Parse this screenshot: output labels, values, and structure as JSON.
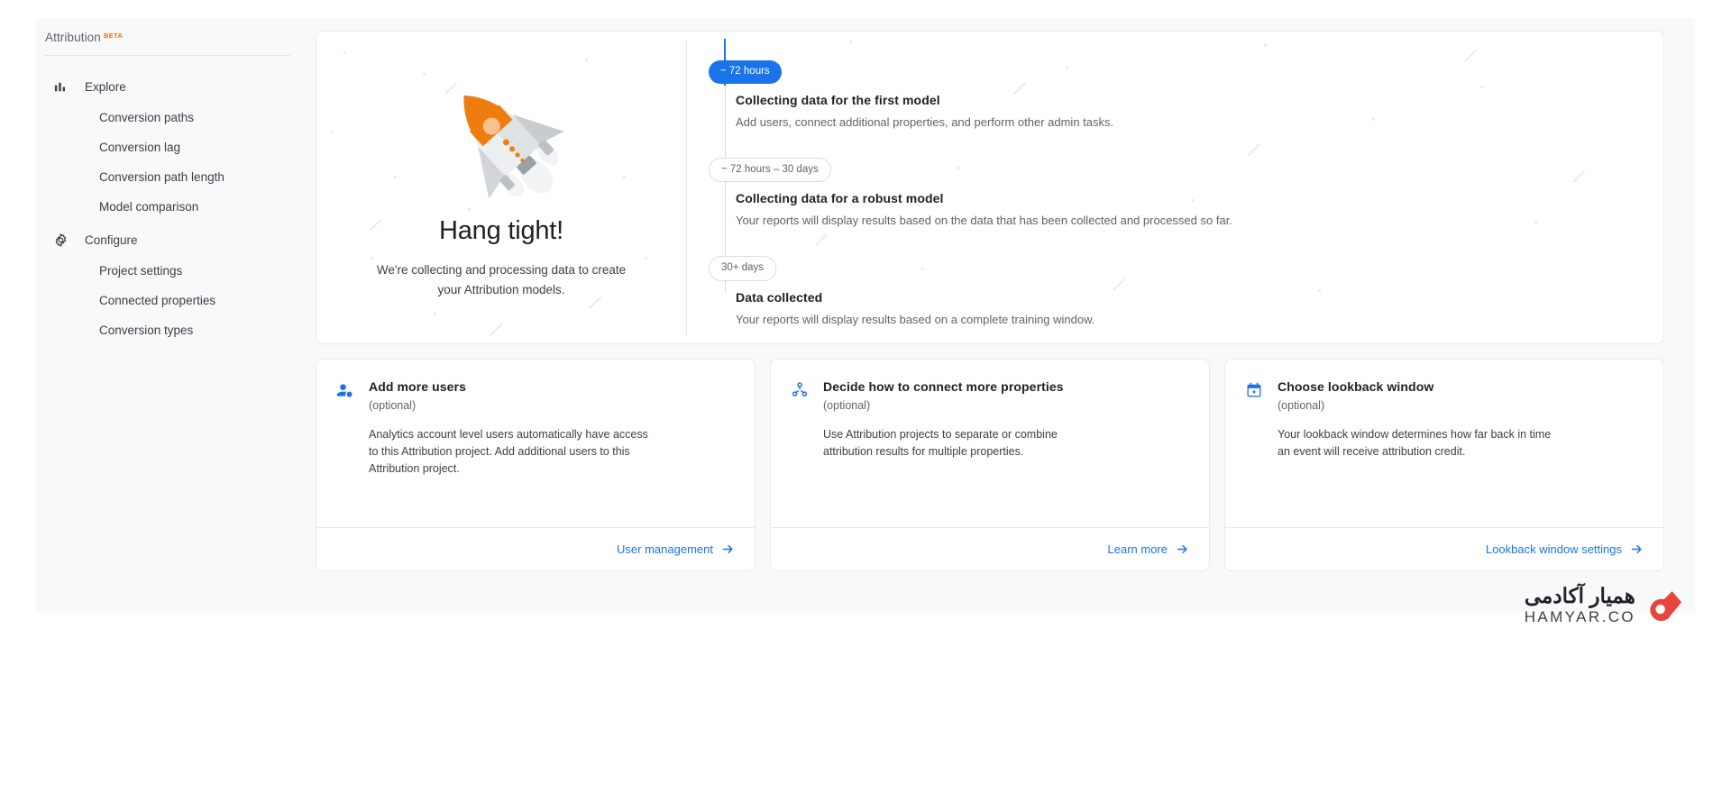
{
  "sidebar": {
    "brand": {
      "title": "Attribution",
      "beta": "BETA"
    },
    "groups": [
      {
        "icon": "bar-chart-icon",
        "label": "Explore",
        "items": [
          {
            "label": "Conversion paths"
          },
          {
            "label": "Conversion lag"
          },
          {
            "label": "Conversion path length"
          },
          {
            "label": "Model comparison"
          }
        ]
      },
      {
        "icon": "gear-icon",
        "label": "Configure",
        "items": [
          {
            "label": "Project settings"
          },
          {
            "label": "Connected properties"
          },
          {
            "label": "Conversion types"
          }
        ]
      }
    ]
  },
  "hero": {
    "illustration": "rocket-illustration",
    "title": "Hang tight!",
    "subtitle": "We're collecting and processing data to create your Attribution models."
  },
  "timeline": {
    "steps": [
      {
        "pill": "~ 72 hours",
        "pill_style": "primary",
        "title": "Collecting data for the first model",
        "desc": "Add users, connect additional properties, and perform other admin tasks."
      },
      {
        "pill": "~ 72 hours – 30 days",
        "pill_style": "ghost",
        "title": "Collecting data for a robust model",
        "desc": "Your reports will display results based on the data that has been collected and processed so far."
      },
      {
        "pill": "30+ days",
        "pill_style": "ghost",
        "title": "Data collected",
        "desc": "Your reports will display results based on a complete training window."
      }
    ]
  },
  "cards": [
    {
      "icon": "add-person-icon",
      "title": "Add more users",
      "optional": "(optional)",
      "desc": "Analytics account level users automatically have access to this Attribution project. Add additional users to this Attribution project.",
      "link": "User management"
    },
    {
      "icon": "hub-network-icon",
      "title": "Decide how to connect more properties",
      "optional": "(optional)",
      "desc": "Use Attribution projects to separate or combine attribution results for multiple properties.",
      "link": "Learn more"
    },
    {
      "icon": "calendar-icon",
      "title": "Choose lookback window",
      "optional": "(optional)",
      "desc": "Your lookback window determines how far back in time an event will receive attribution credit.",
      "link": "Lookback window settings"
    }
  ],
  "watermark": {
    "farsi": "همیار آکادمی",
    "english": "HAMYAR.CO"
  },
  "colors": {
    "accent": "#1a73e8",
    "beta": "#e8710a",
    "rocket_accent": "#f2870d",
    "watermark_logo": "#e8453c"
  }
}
